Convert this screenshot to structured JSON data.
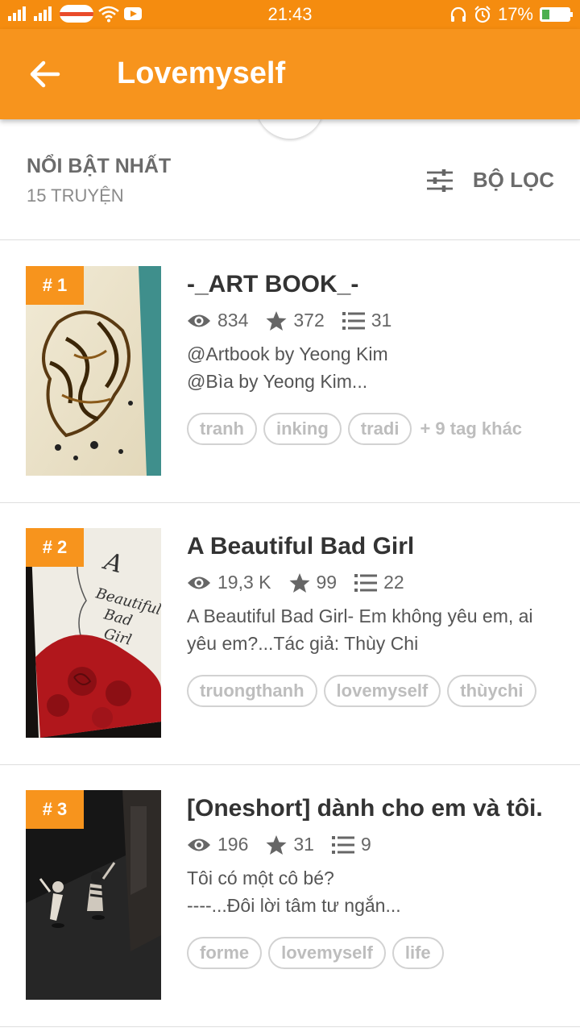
{
  "status_bar": {
    "time": "21:43",
    "battery": "17%"
  },
  "app_bar": {
    "title": "Lovemyself"
  },
  "sort_bar": {
    "sort_label": "NỔI BẬT NHẤT",
    "count_label": "15 TRUYỆN",
    "filter_label": "BỘ LỌC"
  },
  "stories": [
    {
      "rank": "# 1",
      "title": "-_ART BOOK_-",
      "views": "834",
      "votes": "372",
      "parts": "31",
      "desc_line1": "@Artbook by Yeong Kim",
      "desc_line2": "@Bìa by Yeong Kim...",
      "tags": [
        "tranh",
        "inking",
        "tradi"
      ],
      "more_tags": "+ 9 tag khác"
    },
    {
      "rank": "# 2",
      "title": "A Beautiful Bad Girl",
      "views": "19,3 K",
      "votes": "99",
      "parts": "22",
      "desc_line1": "A Beautiful Bad Girl- Em không yêu em, ai",
      "desc_line2": "yêu em?...Tác giả: Thùy Chi",
      "tags": [
        "truongthanh",
        "lovemyself",
        "thùychi"
      ]
    },
    {
      "rank": "# 3",
      "title": "[Oneshort] dành cho em và tôi.",
      "views": "196",
      "votes": "31",
      "parts": "9",
      "desc_line1": "Tôi có một cô bé?",
      "desc_line2": "----...Đôi lời tâm tư ngắn...",
      "tags": [
        "forme",
        "lovemyself",
        "life"
      ]
    }
  ],
  "colors": {
    "primary": "#f7941d",
    "status_bar": "#f58c0f",
    "tag_border": "#d2d2d2",
    "tag_text": "#bdbdbd"
  }
}
